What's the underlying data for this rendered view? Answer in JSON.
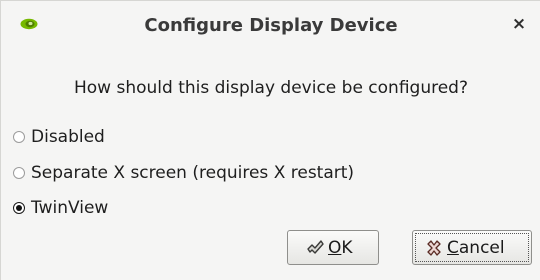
{
  "window": {
    "title": "Configure Display Device",
    "close_symbol": "×",
    "icon": "nvidia-eye-icon",
    "icon_color": "#76b900"
  },
  "prompt": "How should this display device be configured?",
  "options": [
    {
      "label": "Disabled",
      "checked": false
    },
    {
      "label": "Separate X screen (requires X restart)",
      "checked": false
    },
    {
      "label": "TwinView",
      "checked": true
    }
  ],
  "buttons": {
    "ok": {
      "mnemonic": "O",
      "rest": "K",
      "icon": "ok-check-icon"
    },
    "cancel": {
      "mnemonic": "C",
      "rest": "ancel",
      "icon": "cancel-x-icon"
    }
  }
}
